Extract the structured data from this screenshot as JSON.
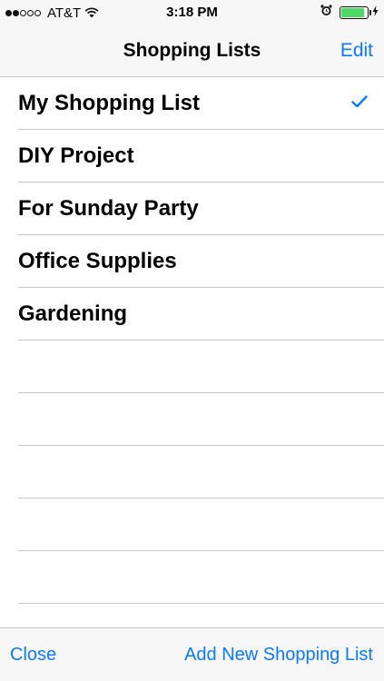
{
  "status_bar": {
    "signal_filled": 2,
    "signal_total": 5,
    "carrier": "AT&T",
    "time": "3:18 PM",
    "battery_level": 0.9,
    "icons": [
      "wifi-icon",
      "alarm-clock-icon",
      "battery-icon",
      "charging-bolt-icon"
    ]
  },
  "nav": {
    "title": "Shopping Lists",
    "edit_label": "Edit"
  },
  "lists": [
    {
      "label": "My Shopping List",
      "selected": true
    },
    {
      "label": "DIY Project",
      "selected": false
    },
    {
      "label": "For Sunday Party",
      "selected": false
    },
    {
      "label": "Office Supplies",
      "selected": false
    },
    {
      "label": "Gardening",
      "selected": false
    }
  ],
  "toolbar": {
    "close_label": "Close",
    "add_label": "Add New Shopping List"
  },
  "colors": {
    "accent": "#0a7aff",
    "battery": "#4cd964",
    "separator": "#c8c7cc",
    "bar_background": "#f7f7f7"
  }
}
